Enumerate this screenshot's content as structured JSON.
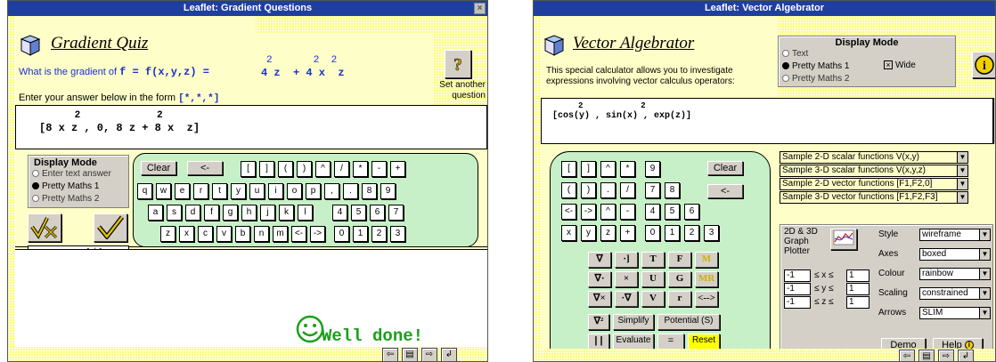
{
  "colors": {
    "title_bar": "#1f3f9f",
    "panel_yellow": "#fefec8",
    "stipple_yellow": "#fbfb88",
    "keypad_green": "#c8f0c8",
    "result_green": "#1aa01a",
    "reset_yellow": "#ffff00",
    "math_blue": "#1a2fd0"
  },
  "gradient": {
    "window_title": "Leaflet: Gradient Questions",
    "quiz_title": "Gradient Quiz",
    "question_prefix": "What is the gradient of",
    "question_func": "f = f(x,y,z) =",
    "expr_exp_line": "2       2  2",
    "expr_main_line": "4 z  + 4 x  z",
    "set_another": "Set another question",
    "instruction": "Enter your answer below in the form",
    "instruction_form": "[*,*,*]",
    "answer_exp_line": "      2             2",
    "answer_main_line": "[8 x z , 0, 8 z + 8 x  z]",
    "display_mode": {
      "title": "Display Mode",
      "options": [
        "Enter text answer",
        "Pretty Maths 1",
        "Pretty Maths 2"
      ],
      "selected": "Pretty Maths 1"
    },
    "score": "score = 1 / 1",
    "keys": {
      "clear": "Clear",
      "back": "<-",
      "row1": [
        "[",
        "]",
        "(",
        ")",
        "^",
        "/",
        "*",
        "-",
        "+"
      ],
      "row2": [
        "q",
        "w",
        "e",
        "r",
        "t",
        "y",
        "u",
        "i",
        "o",
        "p",
        ",",
        ".",
        "8",
        "9"
      ],
      "row3": [
        "a",
        "s",
        "d",
        "f",
        "g",
        "h",
        "j",
        "k",
        "l",
        "4",
        "5",
        "6",
        "7"
      ],
      "row4": [
        "z",
        "x",
        "c",
        "v",
        "b",
        "n",
        "m",
        "<-",
        "->",
        "0",
        "1",
        "2",
        "3"
      ]
    },
    "result": "Well done!"
  },
  "vector": {
    "window_title": "Leaflet: Vector Algebrator",
    "app_title": "Vector Algebrator",
    "description": "This special calculator allows you to investigate expressions involving vector calculus operators:",
    "display_mode": {
      "title": "Display Mode",
      "options": [
        "Text",
        "Pretty Maths 1",
        "Pretty Maths 2"
      ],
      "selected": "Pretty Maths 1",
      "wide_label": "Wide",
      "wide_checked": true
    },
    "expr_exp_line": "     2            2",
    "expr_main_line": "[cos(y) , sin(x) , exp(z)]",
    "keys": {
      "row1": [
        "[",
        "]",
        "^",
        "*",
        "9"
      ],
      "row2": [
        "(",
        ")",
        ".",
        "/",
        "7",
        "8"
      ],
      "row3": [
        "<-",
        "->",
        "^",
        "-",
        "4",
        "5",
        "6"
      ],
      "row4": [
        "x",
        "y",
        "z",
        "+",
        "0",
        "1",
        "2",
        "3"
      ],
      "clear": "Clear",
      "back": "<-"
    },
    "operators": [
      [
        "∇",
        "·]",
        "T",
        "F",
        "M"
      ],
      [
        "∇·",
        "×",
        "U",
        "G",
        "MR"
      ],
      [
        "∇×",
        "·∇",
        "V",
        "r",
        "<-->"
      ]
    ],
    "bottom_ops": {
      "laplacian": "∇²",
      "simplify": "Simplify",
      "potential": "Potential (S)",
      "abs": "| |",
      "evaluate": "Evaluate",
      "equals": "=",
      "reset": "Reset"
    },
    "samples": [
      "Sample 2-D scalar functions V(x,y)",
      "Sample 3-D scalar functions V(x,y,z)",
      "Sample 2-D vector functions [F1,F2,0]",
      "Sample 3-D vector functions [F1,F2,F3]"
    ],
    "plot": {
      "title": "2D & 3D Graph Plotter",
      "style_label": "Style",
      "style_value": "wireframe",
      "axes_label": "Axes",
      "axes_value": "boxed",
      "colour_label": "Colour",
      "colour_value": "rainbow",
      "scaling_label": "Scaling",
      "scaling_value": "constrained",
      "arrows_label": "Arrows",
      "arrows_value": "SLIM",
      "x_min": "-1",
      "x_max": "1",
      "x_rel": "≤ x ≤",
      "y_min": "-1",
      "y_max": "1",
      "y_rel": "≤ y ≤",
      "z_min": "-1",
      "z_max": "1",
      "z_rel": "≤ z ≤"
    },
    "demo": "Demo",
    "help": "Help"
  }
}
